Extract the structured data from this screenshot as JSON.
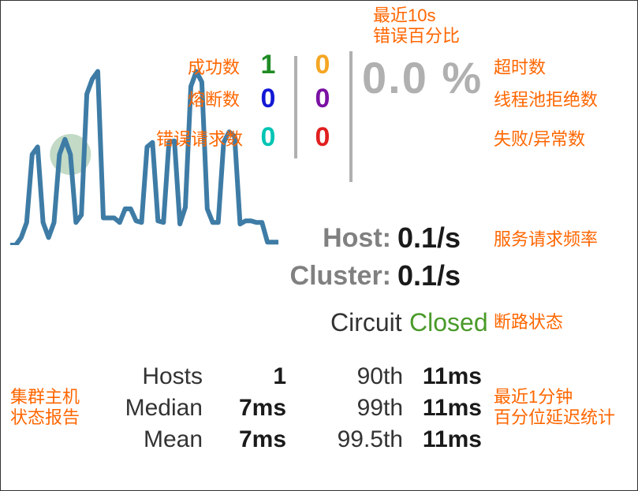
{
  "annotations": {
    "recent_error_pct": "最近10s\n错误百分比",
    "success_count": "成功数",
    "short_circuit_count": "熔断数",
    "bad_request_count": "错误请求数",
    "timeout_count": "超时数",
    "pool_reject_count": "线程池拒绝数",
    "failure_count": "失败/异常数",
    "service_request_rate": "服务请求频率",
    "circuit_state": "断路状态",
    "cluster_host_report": "集群主机\n状态报告",
    "latency_percentile": "最近1分钟\n百分位延迟统计"
  },
  "counters": {
    "left": [
      {
        "value": "1",
        "color": "c-green"
      },
      {
        "value": "0",
        "color": "c-blue"
      },
      {
        "value": "0",
        "color": "c-teal"
      }
    ],
    "right": [
      {
        "value": "0",
        "color": "c-orange"
      },
      {
        "value": "0",
        "color": "c-purple"
      },
      {
        "value": "0",
        "color": "c-red"
      }
    ]
  },
  "error_pct": "0.0 %",
  "rates": {
    "host": {
      "label": "Host:",
      "value": "0.1/s"
    },
    "cluster": {
      "label": "Cluster:",
      "value": "0.1/s"
    }
  },
  "circuit": {
    "label": "Circuit",
    "value": "Closed"
  },
  "host_stats": {
    "rows": [
      {
        "label": "Hosts",
        "value": "1"
      },
      {
        "label": "Median",
        "value": "7ms"
      },
      {
        "label": "Mean",
        "value": "7ms"
      }
    ]
  },
  "percentiles": {
    "rows": [
      {
        "label": "90th",
        "value": "11ms"
      },
      {
        "label": "99th",
        "value": "11ms"
      },
      {
        "label": "99.5th",
        "value": "11ms"
      }
    ]
  },
  "chart_data": {
    "type": "line",
    "title": "",
    "xlabel": "",
    "ylabel": "",
    "x": [
      0,
      1,
      2,
      3,
      4,
      5,
      6,
      7,
      8,
      9,
      10,
      11,
      12,
      13,
      14,
      15,
      16,
      17,
      18,
      19,
      20,
      21,
      22,
      23,
      24,
      25,
      26,
      27,
      28,
      29,
      30,
      31,
      32,
      33,
      34,
      35,
      36,
      37,
      38,
      39,
      40,
      41,
      42,
      43,
      44,
      45,
      46,
      47,
      48,
      49
    ],
    "values": [
      40,
      40,
      45,
      55,
      100,
      105,
      55,
      45,
      55,
      100,
      110,
      100,
      55,
      60,
      140,
      150,
      155,
      58,
      58,
      58,
      55,
      64,
      64,
      56,
      55,
      105,
      108,
      56,
      55,
      108,
      109,
      54,
      65,
      145,
      155,
      148,
      64,
      55,
      55,
      108,
      115,
      112,
      54,
      56,
      56,
      55,
      55,
      42,
      42,
      42
    ],
    "ylim": [
      40,
      160
    ],
    "marker_at_x": 11
  }
}
